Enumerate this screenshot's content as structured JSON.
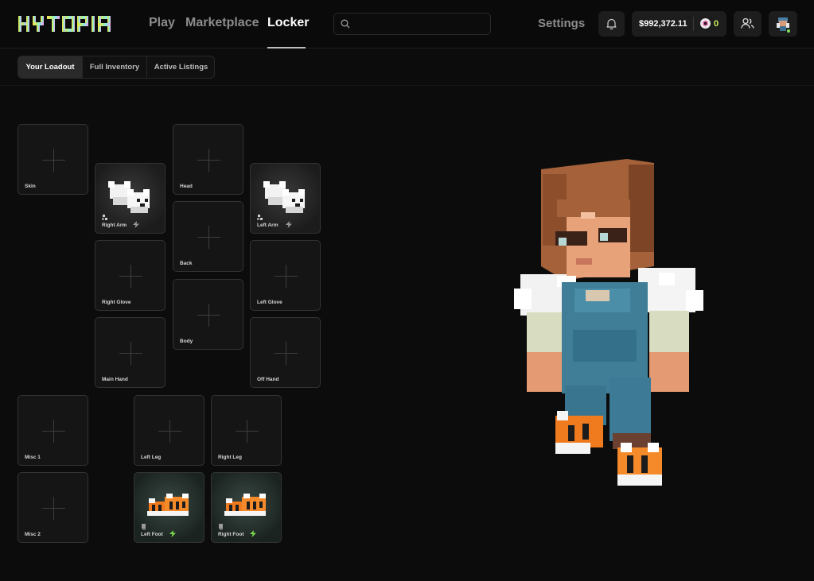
{
  "header": {
    "logo_text": "HYTOPIA",
    "nav": [
      {
        "label": "Play"
      },
      {
        "label": "Marketplace"
      },
      {
        "label": "Locker"
      }
    ],
    "search_placeholder": "",
    "settings_label": "Settings",
    "balance": "$992,372.11",
    "coins": "0"
  },
  "tabs": [
    {
      "label": "Your Loadout"
    },
    {
      "label": "Full Inventory"
    },
    {
      "label": "Active Listings"
    }
  ],
  "slots": {
    "skin": "Skin",
    "head": "Head",
    "right_arm": "Right Arm",
    "left_arm": "Left Arm",
    "back": "Back",
    "right_glove": "Right Glove",
    "left_glove": "Left Glove",
    "body": "Body",
    "main_hand": "Main Hand",
    "off_hand": "Off Hand",
    "misc_1": "Misc 1",
    "left_leg": "Left Leg",
    "right_leg": "Right Leg",
    "misc_2": "Misc 2",
    "left_foot": "Left Foot",
    "right_foot": "Right Foot"
  },
  "colors": {
    "bolt_gray": "#9a9a9a",
    "bolt_green": "#7bdc4a",
    "coin_count": "#c9f25b"
  }
}
